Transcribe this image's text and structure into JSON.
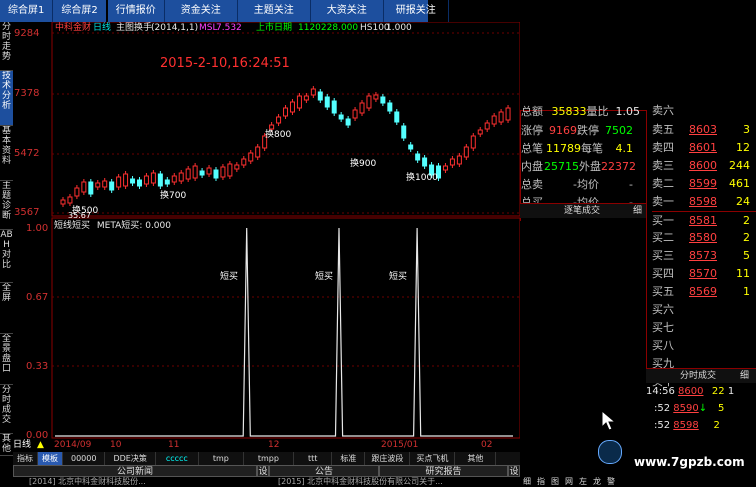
{
  "top_tabs": [
    "综合屏1",
    "综合屏2",
    "行情报价",
    "资金关注",
    "主题关注",
    "大资关注",
    "研报关注"
  ],
  "left_tabs": [
    "分时走势",
    "技术分析",
    "基本资料",
    "主题诊断",
    "ABH对比",
    "全屏",
    "全景盘口",
    "分时成交",
    "其他"
  ],
  "chart": {
    "header": {
      "stock": "中科金财",
      "period": "日线",
      "indicator": "主图换手",
      "params": "(2014,1,1)",
      "msl_label": "MSL",
      "msl_value": "7.532",
      "listed": "上市日期",
      "listed_value": "1120228.000",
      "hs_label": "HS100",
      "hs_value": "1.000"
    },
    "timestamp": "2015-2-10,16:24:51",
    "y_labels": [
      "9284",
      "7378",
      "5472",
      "3567"
    ],
    "annotations": [
      "换500",
      "35.67",
      "换700",
      "换800",
      "换900",
      "换1000"
    ],
    "lower_header": {
      "name": "短线短买",
      "indicator": "META短买",
      "value": "0.000"
    },
    "lower_y_labels": [
      "1.00",
      "0.67",
      "0.33",
      "0.00"
    ],
    "signal_labels": [
      "短买",
      "短买",
      "短买"
    ],
    "x_labels": [
      "2014/09",
      "10",
      "11",
      "12",
      "2015/01",
      "02"
    ],
    "period_label": "日线"
  },
  "chart_data": {
    "type": "line",
    "title": "短线短买 META短买",
    "series": [
      {
        "name": "META短买",
        "values": [
          0,
          0,
          0,
          0,
          0,
          0,
          0,
          0,
          0,
          0,
          0,
          0,
          0,
          0,
          0,
          0,
          0,
          0,
          0,
          0,
          0,
          0,
          0,
          0,
          0,
          0,
          0,
          0,
          0,
          0,
          0,
          0,
          0,
          0,
          0,
          0,
          0,
          0,
          0,
          0,
          0,
          0,
          0,
          0,
          0,
          0,
          0,
          0,
          0,
          0,
          0,
          0,
          0,
          0,
          1,
          0,
          0,
          0,
          0,
          0,
          0,
          0,
          0,
          0,
          0,
          0,
          0,
          0,
          0,
          0,
          0,
          0,
          0,
          0,
          0,
          0,
          0,
          0,
          0,
          0,
          1,
          0,
          0,
          0,
          0,
          0,
          0,
          0,
          0,
          0,
          0,
          0,
          0,
          0,
          0,
          0,
          0,
          0,
          0,
          0,
          0,
          0,
          1,
          0,
          0,
          0,
          0,
          0,
          0,
          0,
          0,
          0,
          0,
          0,
          0,
          0,
          0,
          0,
          0,
          0,
          0,
          0,
          0,
          0,
          0,
          0,
          0,
          0,
          0,
          0
        ]
      }
    ],
    "ylim": [
      0,
      1
    ],
    "ylabels": [
      "0.00",
      "0.33",
      "0.67",
      "1.00"
    ],
    "candles_price_ticks": [
      3567,
      5472,
      7378,
      9284
    ]
  },
  "quote": {
    "rows": [
      {
        "l1": "总额",
        "v1": "35833",
        "l2": "量比",
        "v2": "1.05"
      },
      {
        "l1": "涨停",
        "v1": "9169",
        "l2": "跌停",
        "v2": "7502"
      },
      {
        "l1": "总笔",
        "v1": "11789",
        "l2": "每笔",
        "v2": "4.1"
      },
      {
        "l1": "内盘",
        "v1": "25715",
        "l2": "外盘",
        "v2": "22372"
      },
      {
        "l1": "总卖",
        "v1": "-",
        "l2": "均价",
        "v2": "-"
      },
      {
        "l1": "总买",
        "v1": "-",
        "l2": "均价",
        "v2": "-"
      }
    ],
    "tick_header": "逐笔成交",
    "tick_header2": "细",
    "sell": [
      {
        "label": "卖六",
        "price": "",
        "vol": ""
      },
      {
        "label": "卖五",
        "price": "8603",
        "vol": "3"
      },
      {
        "label": "卖四",
        "price": "8601",
        "vol": "12"
      },
      {
        "label": "卖三",
        "price": "8600",
        "vol": "244"
      },
      {
        "label": "卖二",
        "price": "8599",
        "vol": "461"
      },
      {
        "label": "卖一",
        "price": "8598",
        "vol": "24"
      }
    ],
    "buy": [
      {
        "label": "买一",
        "price": "8581",
        "vol": "2"
      },
      {
        "label": "买二",
        "price": "8580",
        "vol": "2"
      },
      {
        "label": "买三",
        "price": "8573",
        "vol": "5"
      },
      {
        "label": "买四",
        "price": "8570",
        "vol": "11"
      },
      {
        "label": "买五",
        "price": "8569",
        "vol": "1"
      },
      {
        "label": "买六",
        "price": "",
        "vol": ""
      },
      {
        "label": "买七",
        "price": "",
        "vol": ""
      },
      {
        "label": "买八",
        "price": "",
        "vol": ""
      },
      {
        "label": "买九",
        "price": "",
        "vol": ""
      },
      {
        "label": "买十",
        "price": "",
        "vol": ""
      }
    ],
    "fs_header": "分时成交",
    "fs_header2": "细",
    "trades": [
      {
        "time": "14:56",
        "price": "8600",
        "vol": "22",
        "dir": "1"
      },
      {
        "time": ":52",
        "price": "8590",
        "vol": "5",
        "dir": "↓"
      },
      {
        "time": ":52",
        "price": "8598",
        "vol": "2",
        "dir": ""
      }
    ]
  },
  "bottom": {
    "tabs": [
      "指标",
      "模板",
      "00000",
      "DDE决策",
      "ccccc",
      "tmp",
      "tmpp",
      "ttt",
      "标准",
      "跟庄波段",
      "买点飞机",
      "其他"
    ],
    "news": [
      "公司新闻",
      "设",
      "公告",
      "研究报告",
      "设"
    ],
    "ticker1": "[2014] 北京中科金财科技股份...",
    "ticker2": "[2015] 北京中科金财科技股份有限公司关于..."
  },
  "watermark": "www.7gpzb.com",
  "side_tabs": [
    "细",
    "指",
    "图",
    "网",
    "左",
    "龙",
    "警"
  ]
}
